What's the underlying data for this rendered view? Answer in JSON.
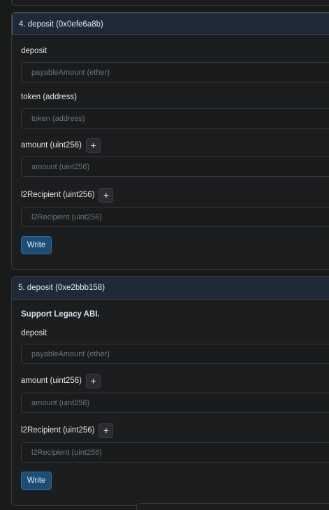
{
  "functions": [
    {
      "header": "4. deposit (0x0efe6a8b)",
      "payable": {
        "label": "deposit",
        "placeholder": "payableAmount (ether)"
      },
      "params": [
        {
          "label": "token (address)",
          "placeholder": "token (address)",
          "expandable": false
        },
        {
          "label": "amount (uint256)",
          "placeholder": "amount (uint256)",
          "expandable": true,
          "plus": "+"
        },
        {
          "label": "l2Recipient (uint256)",
          "placeholder": "l2Recipient (uint256)",
          "expandable": true,
          "plus": "+"
        }
      ],
      "write_label": "Write"
    },
    {
      "header": "5. deposit (0xe2bbb158)",
      "note": "Support Legacy ABI.",
      "payable": {
        "label": "deposit",
        "placeholder": "payableAmount (ether)"
      },
      "params": [
        {
          "label": "amount (uint256)",
          "placeholder": "amount (uint256)",
          "expandable": true,
          "plus": "+"
        },
        {
          "label": "l2Recipient (uint256)",
          "placeholder": "l2Recipient (uint256)",
          "expandable": true,
          "plus": "+"
        }
      ],
      "write_label": "Write"
    }
  ]
}
